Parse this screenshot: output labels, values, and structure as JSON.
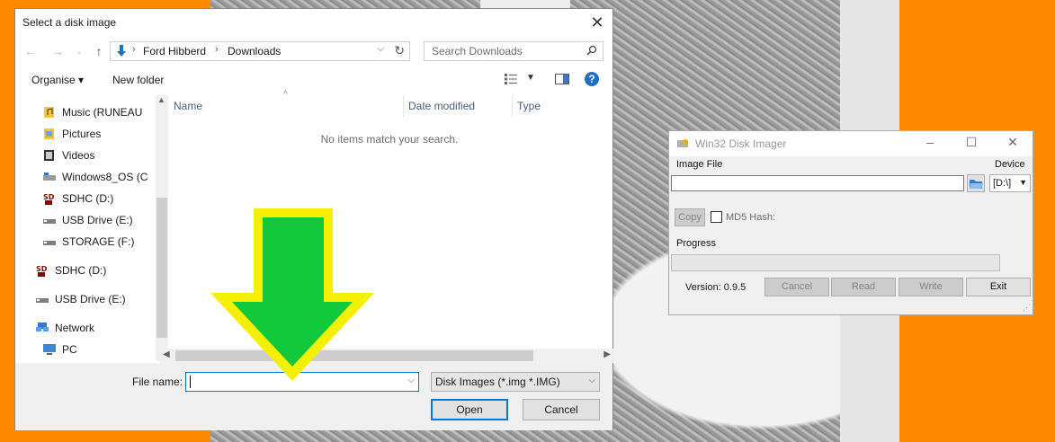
{
  "dialog": {
    "title": "Select a disk image",
    "breadcrumb": [
      "Ford Hibberd",
      "Downloads"
    ],
    "search_placeholder": "Search Downloads",
    "toolbar": {
      "organise": "Organise ▾",
      "new_folder": "New folder",
      "help": "?"
    },
    "nav_items": [
      {
        "label": "Music (RUNEAU",
        "icon": "music-folder-icon"
      },
      {
        "label": "Pictures",
        "icon": "pictures-folder-icon"
      },
      {
        "label": "Videos",
        "icon": "videos-folder-icon"
      },
      {
        "label": "Windows8_OS (C",
        "icon": "drive-icon"
      },
      {
        "label": "SDHC (D:)",
        "icon": "sd-card-icon"
      },
      {
        "label": "USB Drive (E:)",
        "icon": "usb-drive-icon"
      },
      {
        "label": "STORAGE (F:)",
        "icon": "usb-drive-icon"
      },
      {
        "label": "SDHC (D:)",
        "icon": "sd-card-icon"
      },
      {
        "label": "USB Drive (E:)",
        "icon": "usb-drive-icon"
      },
      {
        "label": "Network",
        "icon": "network-icon"
      },
      {
        "label": "PC",
        "icon": "pc-icon"
      }
    ],
    "columns": [
      "Name",
      "Date modified",
      "Type"
    ],
    "empty_message": "No items match your search.",
    "file_name_label": "File name:",
    "file_name_value": "",
    "filter": "Disk Images (*.img *.IMG)",
    "open_label": "Open",
    "cancel_label": "Cancel"
  },
  "disk_imager": {
    "title": "Win32 Disk Imager",
    "image_file_label": "Image File",
    "device_label": "Device",
    "device_value": "[D:\\]",
    "copy_label": "Copy",
    "md5_label": "MD5 Hash:",
    "progress_label": "Progress",
    "progress": 0,
    "version": "Version: 0.9.5",
    "buttons": {
      "cancel": "Cancel",
      "read": "Read",
      "write": "Write",
      "exit": "Exit"
    }
  },
  "colors": {
    "background": "#ff8a00",
    "arrow_fill": "#12c93c",
    "arrow_outline": "#f5f000",
    "accent": "#0078d7"
  }
}
